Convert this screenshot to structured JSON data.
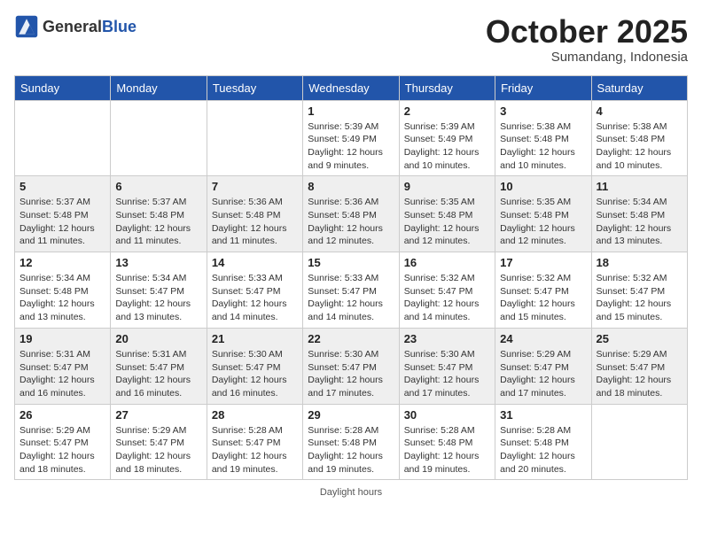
{
  "header": {
    "logo_general": "General",
    "logo_blue": "Blue",
    "month_title": "October 2025",
    "subtitle": "Sumandang, Indonesia"
  },
  "days_of_week": [
    "Sunday",
    "Monday",
    "Tuesday",
    "Wednesday",
    "Thursday",
    "Friday",
    "Saturday"
  ],
  "weeks": [
    [
      {
        "day": "",
        "sunrise": "",
        "sunset": "",
        "daylight": ""
      },
      {
        "day": "",
        "sunrise": "",
        "sunset": "",
        "daylight": ""
      },
      {
        "day": "",
        "sunrise": "",
        "sunset": "",
        "daylight": ""
      },
      {
        "day": "1",
        "sunrise": "Sunrise: 5:39 AM",
        "sunset": "Sunset: 5:49 PM",
        "daylight": "Daylight: 12 hours and 9 minutes."
      },
      {
        "day": "2",
        "sunrise": "Sunrise: 5:39 AM",
        "sunset": "Sunset: 5:49 PM",
        "daylight": "Daylight: 12 hours and 10 minutes."
      },
      {
        "day": "3",
        "sunrise": "Sunrise: 5:38 AM",
        "sunset": "Sunset: 5:48 PM",
        "daylight": "Daylight: 12 hours and 10 minutes."
      },
      {
        "day": "4",
        "sunrise": "Sunrise: 5:38 AM",
        "sunset": "Sunset: 5:48 PM",
        "daylight": "Daylight: 12 hours and 10 minutes."
      }
    ],
    [
      {
        "day": "5",
        "sunrise": "Sunrise: 5:37 AM",
        "sunset": "Sunset: 5:48 PM",
        "daylight": "Daylight: 12 hours and 11 minutes."
      },
      {
        "day": "6",
        "sunrise": "Sunrise: 5:37 AM",
        "sunset": "Sunset: 5:48 PM",
        "daylight": "Daylight: 12 hours and 11 minutes."
      },
      {
        "day": "7",
        "sunrise": "Sunrise: 5:36 AM",
        "sunset": "Sunset: 5:48 PM",
        "daylight": "Daylight: 12 hours and 11 minutes."
      },
      {
        "day": "8",
        "sunrise": "Sunrise: 5:36 AM",
        "sunset": "Sunset: 5:48 PM",
        "daylight": "Daylight: 12 hours and 12 minutes."
      },
      {
        "day": "9",
        "sunrise": "Sunrise: 5:35 AM",
        "sunset": "Sunset: 5:48 PM",
        "daylight": "Daylight: 12 hours and 12 minutes."
      },
      {
        "day": "10",
        "sunrise": "Sunrise: 5:35 AM",
        "sunset": "Sunset: 5:48 PM",
        "daylight": "Daylight: 12 hours and 12 minutes."
      },
      {
        "day": "11",
        "sunrise": "Sunrise: 5:34 AM",
        "sunset": "Sunset: 5:48 PM",
        "daylight": "Daylight: 12 hours and 13 minutes."
      }
    ],
    [
      {
        "day": "12",
        "sunrise": "Sunrise: 5:34 AM",
        "sunset": "Sunset: 5:48 PM",
        "daylight": "Daylight: 12 hours and 13 minutes."
      },
      {
        "day": "13",
        "sunrise": "Sunrise: 5:34 AM",
        "sunset": "Sunset: 5:47 PM",
        "daylight": "Daylight: 12 hours and 13 minutes."
      },
      {
        "day": "14",
        "sunrise": "Sunrise: 5:33 AM",
        "sunset": "Sunset: 5:47 PM",
        "daylight": "Daylight: 12 hours and 14 minutes."
      },
      {
        "day": "15",
        "sunrise": "Sunrise: 5:33 AM",
        "sunset": "Sunset: 5:47 PM",
        "daylight": "Daylight: 12 hours and 14 minutes."
      },
      {
        "day": "16",
        "sunrise": "Sunrise: 5:32 AM",
        "sunset": "Sunset: 5:47 PM",
        "daylight": "Daylight: 12 hours and 14 minutes."
      },
      {
        "day": "17",
        "sunrise": "Sunrise: 5:32 AM",
        "sunset": "Sunset: 5:47 PM",
        "daylight": "Daylight: 12 hours and 15 minutes."
      },
      {
        "day": "18",
        "sunrise": "Sunrise: 5:32 AM",
        "sunset": "Sunset: 5:47 PM",
        "daylight": "Daylight: 12 hours and 15 minutes."
      }
    ],
    [
      {
        "day": "19",
        "sunrise": "Sunrise: 5:31 AM",
        "sunset": "Sunset: 5:47 PM",
        "daylight": "Daylight: 12 hours and 16 minutes."
      },
      {
        "day": "20",
        "sunrise": "Sunrise: 5:31 AM",
        "sunset": "Sunset: 5:47 PM",
        "daylight": "Daylight: 12 hours and 16 minutes."
      },
      {
        "day": "21",
        "sunrise": "Sunrise: 5:30 AM",
        "sunset": "Sunset: 5:47 PM",
        "daylight": "Daylight: 12 hours and 16 minutes."
      },
      {
        "day": "22",
        "sunrise": "Sunrise: 5:30 AM",
        "sunset": "Sunset: 5:47 PM",
        "daylight": "Daylight: 12 hours and 17 minutes."
      },
      {
        "day": "23",
        "sunrise": "Sunrise: 5:30 AM",
        "sunset": "Sunset: 5:47 PM",
        "daylight": "Daylight: 12 hours and 17 minutes."
      },
      {
        "day": "24",
        "sunrise": "Sunrise: 5:29 AM",
        "sunset": "Sunset: 5:47 PM",
        "daylight": "Daylight: 12 hours and 17 minutes."
      },
      {
        "day": "25",
        "sunrise": "Sunrise: 5:29 AM",
        "sunset": "Sunset: 5:47 PM",
        "daylight": "Daylight: 12 hours and 18 minutes."
      }
    ],
    [
      {
        "day": "26",
        "sunrise": "Sunrise: 5:29 AM",
        "sunset": "Sunset: 5:47 PM",
        "daylight": "Daylight: 12 hours and 18 minutes."
      },
      {
        "day": "27",
        "sunrise": "Sunrise: 5:29 AM",
        "sunset": "Sunset: 5:47 PM",
        "daylight": "Daylight: 12 hours and 18 minutes."
      },
      {
        "day": "28",
        "sunrise": "Sunrise: 5:28 AM",
        "sunset": "Sunset: 5:47 PM",
        "daylight": "Daylight: 12 hours and 19 minutes."
      },
      {
        "day": "29",
        "sunrise": "Sunrise: 5:28 AM",
        "sunset": "Sunset: 5:48 PM",
        "daylight": "Daylight: 12 hours and 19 minutes."
      },
      {
        "day": "30",
        "sunrise": "Sunrise: 5:28 AM",
        "sunset": "Sunset: 5:48 PM",
        "daylight": "Daylight: 12 hours and 19 minutes."
      },
      {
        "day": "31",
        "sunrise": "Sunrise: 5:28 AM",
        "sunset": "Sunset: 5:48 PM",
        "daylight": "Daylight: 12 hours and 20 minutes."
      },
      {
        "day": "",
        "sunrise": "",
        "sunset": "",
        "daylight": ""
      }
    ]
  ],
  "footer": {
    "note": "Daylight hours"
  }
}
